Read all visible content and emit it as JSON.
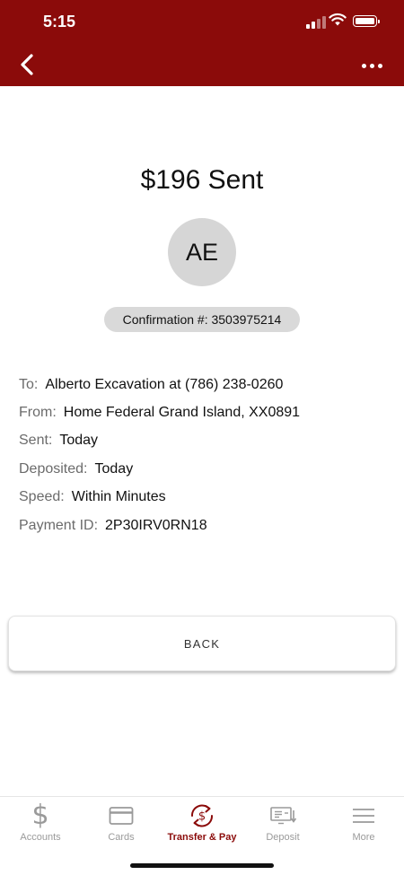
{
  "status_bar": {
    "time": "5:15"
  },
  "header": {
    "back_icon": "chevron-left-icon",
    "more_icon": "more-dots-icon",
    "color": "#8b0b0a"
  },
  "title": "$196 Sent",
  "avatar": {
    "initials": "AE"
  },
  "confirmation": "Confirmation #: 3503975214",
  "details": [
    {
      "label": "To:",
      "value": "Alberto Excavation at (786) 238-0260"
    },
    {
      "label": "From:",
      "value": "Home Federal Grand Island, XX0891"
    },
    {
      "label": "Sent:",
      "value": "Today"
    },
    {
      "label": "Deposited:",
      "value": "Today"
    },
    {
      "label": "Speed:",
      "value": "Within Minutes"
    },
    {
      "label": "Payment ID:",
      "value": "2P30IRV0RN18"
    }
  ],
  "back_button": {
    "label": "BACK"
  },
  "tabbar": {
    "active_color": "#8b0b0a",
    "tabs": [
      {
        "label": "Accounts",
        "icon": "dollar-icon",
        "active": false
      },
      {
        "label": "Cards",
        "icon": "card-icon",
        "active": false
      },
      {
        "label": "Transfer & Pay",
        "icon": "transfer-pay-icon",
        "active": true
      },
      {
        "label": "Deposit",
        "icon": "check-deposit-icon",
        "active": false
      },
      {
        "label": "More",
        "icon": "menu-icon",
        "active": false
      }
    ]
  }
}
